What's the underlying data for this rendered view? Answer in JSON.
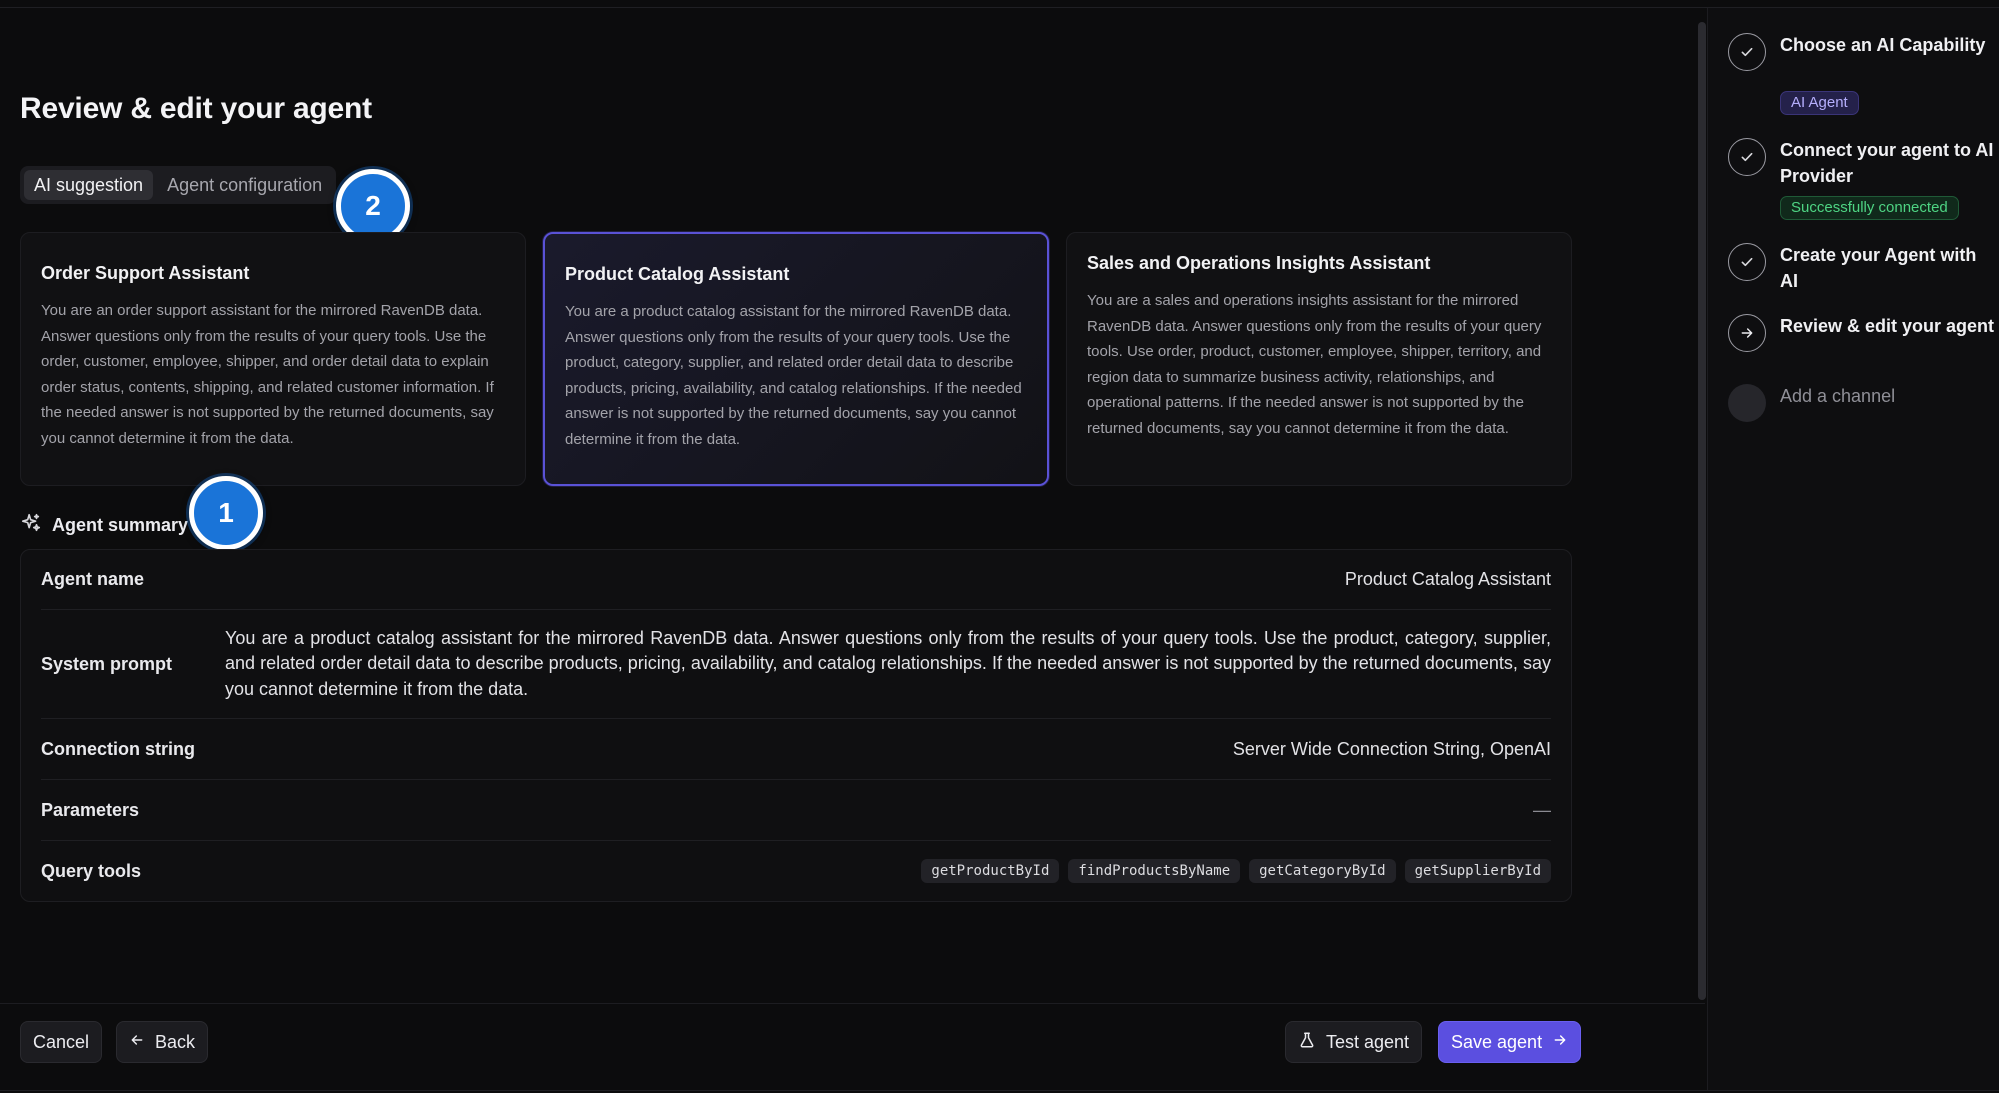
{
  "page": {
    "title": "Review & edit your agent"
  },
  "tabs": [
    {
      "label": "AI suggestion",
      "active": true
    },
    {
      "label": "Agent configuration",
      "active": false
    }
  ],
  "annotations": {
    "one": "1",
    "two": "2"
  },
  "cards": [
    {
      "title": "Order Support Assistant",
      "description": "You are an order support assistant for the mirrored RavenDB data. Answer questions only from the results of your query tools. Use the order, customer, employee, shipper, and order detail data to explain order status, contents, shipping, and related customer information. If the needed answer is not supported by the returned documents, say you cannot determine it from the data."
    },
    {
      "title": "Product Catalog Assistant",
      "description": "You are a product catalog assistant for the mirrored RavenDB data. Answer questions only from the results of your query tools. Use the product, category, supplier, and related order detail data to describe products, pricing, availability, and catalog relationships. If the needed answer is not supported by the returned documents, say you cannot determine it from the data."
    },
    {
      "title": "Sales and Operations Insights Assistant",
      "description": "You are a sales and operations insights assistant for the mirrored RavenDB data. Answer questions only from the results of your query tools. Use order, product, customer, employee, shipper, territory, and region data to summarize business activity, relationships, and operational patterns. If the needed answer is not supported by the returned documents, say you cannot determine it from the data."
    }
  ],
  "summary": {
    "heading": "Agent summary",
    "agent_name_label": "Agent name",
    "agent_name_value": "Product Catalog Assistant",
    "system_prompt_label": "System prompt",
    "system_prompt_value": "You are a product catalog assistant for the mirrored RavenDB data. Answer questions only from the results of your query tools. Use the product, category, supplier, and related order detail data to describe products, pricing, availability, and catalog relationships. If the needed answer is not supported by the returned documents, say you cannot determine it from the data.",
    "connection_label": "Connection string",
    "connection_value": "Server Wide Connection String, OpenAI",
    "parameters_label": "Parameters",
    "parameters_value": "—",
    "query_tools_label": "Query tools",
    "query_tools": [
      "getProductById",
      "findProductsByName",
      "getCategoryById",
      "getSupplierById"
    ]
  },
  "footer": {
    "cancel": "Cancel",
    "back": "Back",
    "test": "Test agent",
    "save": "Save agent"
  },
  "steps": [
    {
      "label": "Choose an AI Capability",
      "tag": "AI Agent",
      "state": "done"
    },
    {
      "label": "Connect your agent to AI Provider",
      "tag": "Successfully connected",
      "state": "done"
    },
    {
      "label": "Create your Agent with AI",
      "state": "done"
    },
    {
      "label": "Review & edit your agent",
      "state": "current"
    },
    {
      "label": "Add a channel",
      "state": "pending"
    }
  ],
  "colors": {
    "accent": "#5b4fe0",
    "success": "#4ed483",
    "annotation": "#1a74d8"
  }
}
